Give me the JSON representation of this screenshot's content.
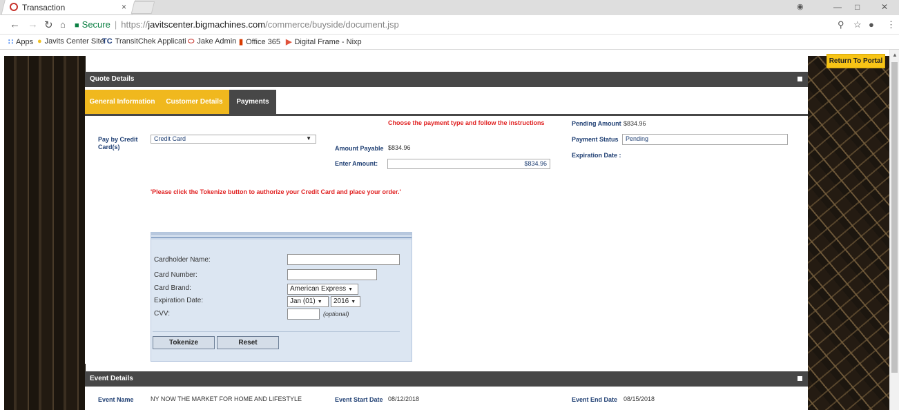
{
  "browser": {
    "tab_title": "Transaction",
    "tab_close": "×",
    "url_secure": "Secure",
    "url_scheme": "https://",
    "url_host": "javitscenter.bigmachines.com",
    "url_path": "/commerce/buyside/document.jsp",
    "bookmarks": [
      {
        "label": "Apps",
        "icon": "apps-grid-icon"
      },
      {
        "label": "Javits Center Site",
        "icon": "yellow-dot-icon"
      },
      {
        "label": "TransitChek Applicati",
        "icon": "tc-logo-icon",
        "icon_text": "TC"
      },
      {
        "label": "Jake Admin",
        "icon": "oracle-icon"
      },
      {
        "label": "Office 365",
        "icon": "office-icon"
      },
      {
        "label": "Digital Frame - Nixp",
        "icon": "nixplay-icon"
      }
    ]
  },
  "portal_button": "Return To Portal",
  "quote": {
    "header": "Quote Details",
    "tabs": [
      {
        "label": "General Information",
        "active": false
      },
      {
        "label": "Customer Details",
        "active": false
      },
      {
        "label": "Payments",
        "active": true
      }
    ],
    "instruction": "Choose the payment type and follow the instructions",
    "pay_by_label": "Pay by Credit Card(s)",
    "pay_by_value": "Credit Card",
    "amount_payable_label": "Amount Payable",
    "amount_payable_value": "$834.96",
    "enter_amount_label": "Enter Amount:",
    "enter_amount_value": "$834.96",
    "pending_amount_label": "Pending Amount",
    "pending_amount_value": "$834.96",
    "payment_status_label": "Payment Status",
    "payment_status_value": "Pending",
    "expiration_date_label": "Expiration Date :",
    "tokenize_notice": "'Please click the Tokenize button to authorize your Credit Card and place your order.'"
  },
  "card_form": {
    "cardholder_label": "Cardholder Name:",
    "card_number_label": "Card Number:",
    "card_brand_label": "Card Brand:",
    "card_brand_value": "American Express",
    "expiration_label": "Expiration Date:",
    "exp_month_value": "Jan (01)",
    "exp_year_value": "2016",
    "cvv_label": "CVV:",
    "cvv_hint": "(optional)",
    "tokenize_button": "Tokenize",
    "reset_button": "Reset"
  },
  "event": {
    "header": "Event Details",
    "name_label": "Event Name",
    "name_value": "NY NOW THE MARKET FOR HOME AND LIFESTYLE",
    "start_label": "Event Start Date",
    "start_value": "08/12/2018",
    "end_label": "Event End Date",
    "end_value": "08/15/2018"
  },
  "colors": {
    "tab_yellow": "#f0b81e",
    "header_gray": "#474747",
    "label_blue": "#1f3f73",
    "alert_red": "#e02020",
    "portal_yellow": "#f7c416"
  }
}
